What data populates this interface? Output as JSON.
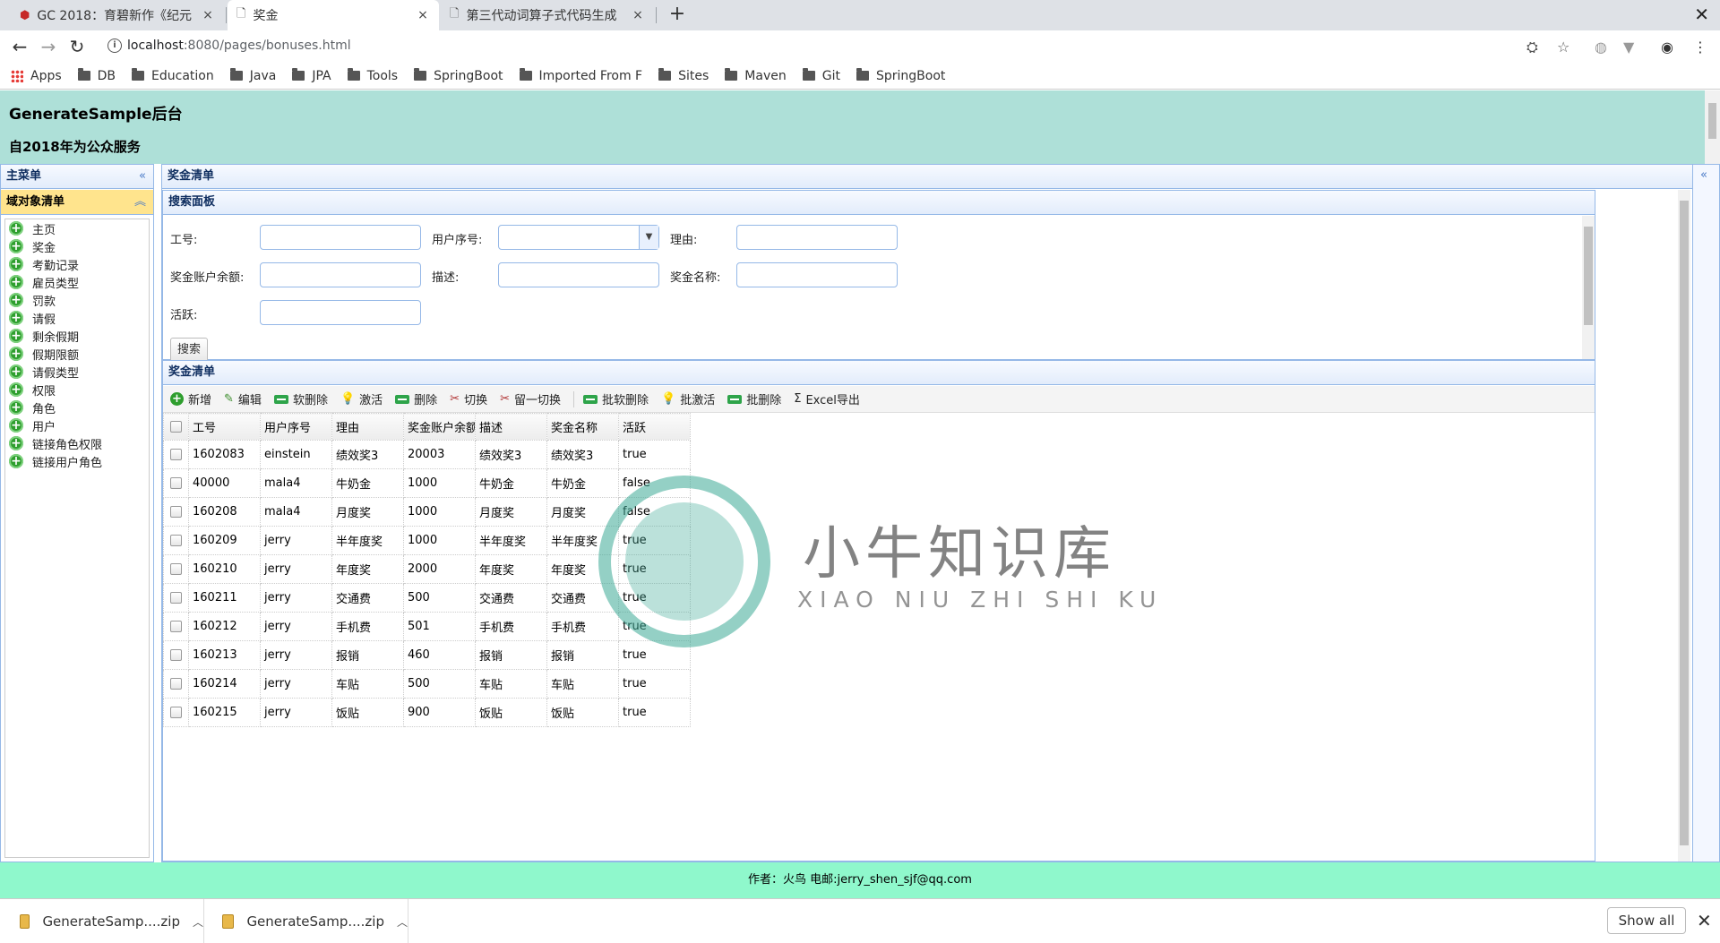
{
  "browser": {
    "tabs": [
      {
        "title": "GC 2018：育碧新作《纪元",
        "close": "×"
      },
      {
        "title": "奖金",
        "close": "×"
      },
      {
        "title": "第三代动词算子式代码生成",
        "close": "×"
      }
    ],
    "new_tab": "+",
    "url_host": "localhost",
    "url_rest": ":8080/pages/bonuses.html",
    "bookmarks": [
      "Apps",
      "DB",
      "Education",
      "Java",
      "JPA",
      "Tools",
      "SpringBoot",
      "Imported From F",
      "Sites",
      "Maven",
      "Git",
      "SpringBoot"
    ]
  },
  "header": {
    "title": "GenerateSample后台",
    "subtitle": "自2018年为公众服务"
  },
  "sidebar": {
    "title": "主菜单",
    "section": "域对象清单",
    "items": [
      "主页",
      "奖金",
      "考勤记录",
      "雇员类型",
      "罚款",
      "请假",
      "剩余假期",
      "假期限额",
      "请假类型",
      "权限",
      "角色",
      "用户",
      "链接角色权限",
      "链接用户角色"
    ]
  },
  "content": {
    "title": "奖金清单",
    "search_panel": {
      "title": "搜索面板",
      "labels": {
        "emp_id": "工号:",
        "user_seq": "用户序号:",
        "reason": "理由:",
        "balance": "奖金账户余额:",
        "desc": "描述:",
        "bonus_name": "奖金名称:",
        "active": "活跃:"
      },
      "values": {
        "emp_id": "",
        "user_seq": "",
        "reason": "",
        "balance": "",
        "desc": "",
        "bonus_name": "",
        "active": ""
      },
      "search_button": "搜索"
    },
    "grid": {
      "title": "奖金清单",
      "toolbar": [
        "新增",
        "编辑",
        "软删除",
        "激活",
        "删除",
        "切换",
        "留一切换",
        "批软删除",
        "批激活",
        "批删除",
        "Excel导出"
      ],
      "columns": [
        "工号",
        "用户序号",
        "理由",
        "奖金账户余额",
        "描述",
        "奖金名称",
        "活跃"
      ],
      "rows": [
        [
          "1602083",
          "einstein",
          "绩效奖3",
          "20003",
          "绩效奖3",
          "绩效奖3",
          "true"
        ],
        [
          "40000",
          "mala4",
          "牛奶金",
          "1000",
          "牛奶金",
          "牛奶金",
          "false"
        ],
        [
          "160208",
          "mala4",
          "月度奖",
          "1000",
          "月度奖",
          "月度奖",
          "false"
        ],
        [
          "160209",
          "jerry",
          "半年度奖",
          "1000",
          "半年度奖",
          "半年度奖",
          "true"
        ],
        [
          "160210",
          "jerry",
          "年度奖",
          "2000",
          "年度奖",
          "年度奖",
          "true"
        ],
        [
          "160211",
          "jerry",
          "交通费",
          "500",
          "交通费",
          "交通费",
          "true"
        ],
        [
          "160212",
          "jerry",
          "手机费",
          "501",
          "手机费",
          "手机费",
          "true"
        ],
        [
          "160213",
          "jerry",
          "报销",
          "460",
          "报销",
          "报销",
          "true"
        ],
        [
          "160214",
          "jerry",
          "车贴",
          "500",
          "车贴",
          "车贴",
          "true"
        ],
        [
          "160215",
          "jerry",
          "饭贴",
          "900",
          "饭贴",
          "饭贴",
          "true"
        ]
      ]
    }
  },
  "footer": "作者：火鸟 电邮:jerry_shen_sjf@qq.com",
  "watermark": {
    "text": "小牛知识库",
    "sub": "XIAO NIU ZHI SHI KU"
  },
  "downloads": {
    "items": [
      "GenerateSamp....zip",
      "GenerateSamp....zip"
    ],
    "show_all": "Show all"
  }
}
